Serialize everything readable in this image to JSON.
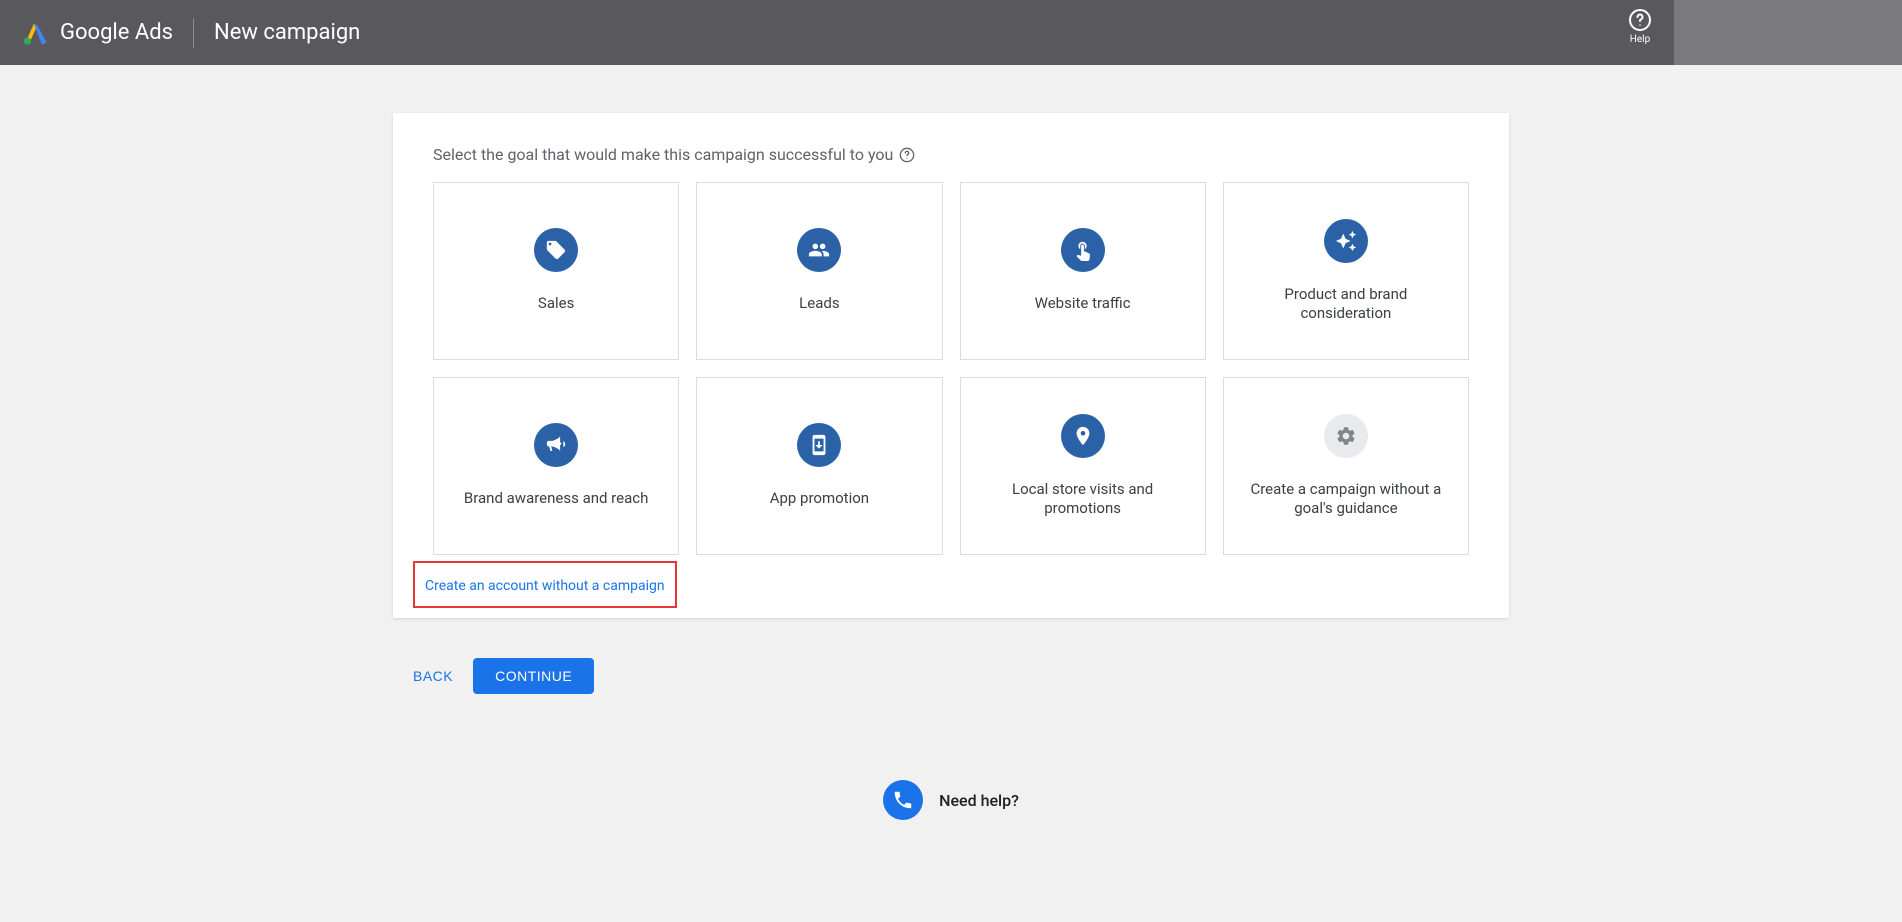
{
  "header": {
    "product_name": "Google Ads",
    "page_title": "New campaign",
    "help_label": "Help"
  },
  "card": {
    "prompt": "Select the goal that would make this campaign successful to you",
    "goals": [
      {
        "label": "Sales",
        "icon": "tag-icon"
      },
      {
        "label": "Leads",
        "icon": "people-icon"
      },
      {
        "label": "Website traffic",
        "icon": "click-icon"
      },
      {
        "label": "Product and brand consideration",
        "icon": "sparkle-icon"
      },
      {
        "label": "Brand awareness and reach",
        "icon": "megaphone-icon"
      },
      {
        "label": "App promotion",
        "icon": "phone-icon"
      },
      {
        "label": "Local store visits and promotions",
        "icon": "pin-icon"
      },
      {
        "label": "Create a campaign without a goal's guidance",
        "icon": "gear-icon",
        "grey": true
      }
    ],
    "skip_link": "Create an account without a campaign"
  },
  "footer": {
    "back": "BACK",
    "continue": "CONTINUE",
    "need_help": "Need help?"
  }
}
